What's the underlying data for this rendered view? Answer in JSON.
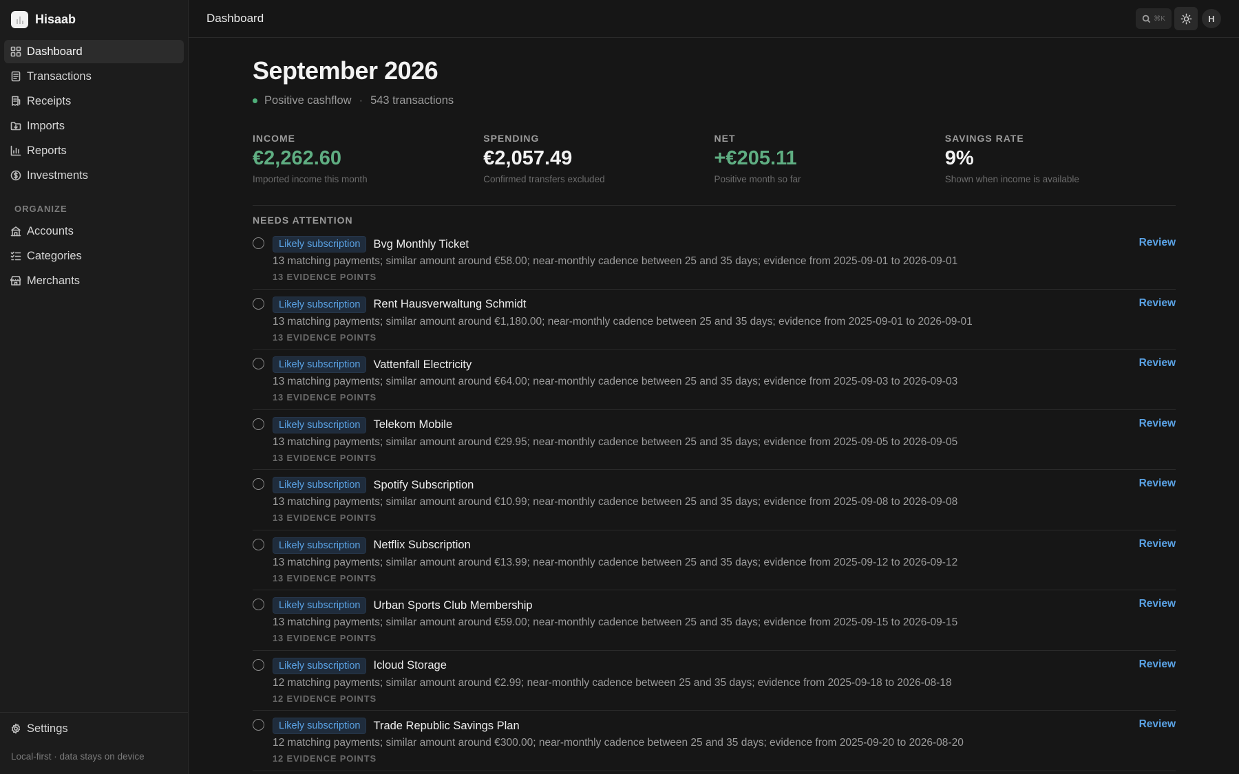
{
  "app": {
    "name": "Hisaab"
  },
  "sidebar": {
    "items": [
      {
        "label": "Dashboard",
        "icon": "dashboard-icon",
        "active": true
      },
      {
        "label": "Transactions",
        "icon": "transactions-icon"
      },
      {
        "label": "Receipts",
        "icon": "receipts-icon"
      },
      {
        "label": "Imports",
        "icon": "imports-icon"
      },
      {
        "label": "Reports",
        "icon": "reports-icon"
      },
      {
        "label": "Investments",
        "icon": "investments-icon"
      }
    ],
    "organize_label": "ORGANIZE",
    "organize_items": [
      {
        "label": "Accounts",
        "icon": "accounts-icon"
      },
      {
        "label": "Categories",
        "icon": "categories-icon"
      },
      {
        "label": "Merchants",
        "icon": "merchants-icon"
      }
    ],
    "settings_label": "Settings",
    "footnote": "Local-first · data stays on device"
  },
  "topbar": {
    "title": "Dashboard",
    "search_shortcut": "⌘K",
    "avatar_initial": "H"
  },
  "page": {
    "title": "September 2026",
    "status": "Positive cashflow",
    "separator": "·",
    "transactions_count": "543 transactions"
  },
  "stats": [
    {
      "label": "INCOME",
      "value": "€2,262.60",
      "note": "Imported income this month",
      "tone": "green"
    },
    {
      "label": "SPENDING",
      "value": "€2,057.49",
      "note": "Confirmed transfers excluded",
      "tone": "neutral"
    },
    {
      "label": "NET",
      "value": "+€205.11",
      "note": "Positive month so far",
      "tone": "green"
    },
    {
      "label": "SAVINGS RATE",
      "value": "9%",
      "note": "Shown when income is available",
      "tone": "neutral"
    }
  ],
  "attention": {
    "label": "NEEDS ATTENTION",
    "review_label": "Review",
    "items": [
      {
        "badge": "Likely subscription",
        "title": "Bvg Monthly Ticket",
        "desc": "13 matching payments; similar amount around €58.00; near-monthly cadence between 25 and 35 days; evidence from 2025-09-01 to 2026-09-01",
        "evidence": "13 EVIDENCE POINTS"
      },
      {
        "badge": "Likely subscription",
        "title": "Rent Hausverwaltung Schmidt",
        "desc": "13 matching payments; similar amount around €1,180.00; near-monthly cadence between 25 and 35 days; evidence from 2025-09-01 to 2026-09-01",
        "evidence": "13 EVIDENCE POINTS"
      },
      {
        "badge": "Likely subscription",
        "title": "Vattenfall Electricity",
        "desc": "13 matching payments; similar amount around €64.00; near-monthly cadence between 25 and 35 days; evidence from 2025-09-03 to 2026-09-03",
        "evidence": "13 EVIDENCE POINTS"
      },
      {
        "badge": "Likely subscription",
        "title": "Telekom Mobile",
        "desc": "13 matching payments; similar amount around €29.95; near-monthly cadence between 25 and 35 days; evidence from 2025-09-05 to 2026-09-05",
        "evidence": "13 EVIDENCE POINTS"
      },
      {
        "badge": "Likely subscription",
        "title": "Spotify Subscription",
        "desc": "13 matching payments; similar amount around €10.99; near-monthly cadence between 25 and 35 days; evidence from 2025-09-08 to 2026-09-08",
        "evidence": "13 EVIDENCE POINTS"
      },
      {
        "badge": "Likely subscription",
        "title": "Netflix Subscription",
        "desc": "13 matching payments; similar amount around €13.99; near-monthly cadence between 25 and 35 days; evidence from 2025-09-12 to 2026-09-12",
        "evidence": "13 EVIDENCE POINTS"
      },
      {
        "badge": "Likely subscription",
        "title": "Urban Sports Club Membership",
        "desc": "13 matching payments; similar amount around €59.00; near-monthly cadence between 25 and 35 days; evidence from 2025-09-15 to 2026-09-15",
        "evidence": "13 EVIDENCE POINTS"
      },
      {
        "badge": "Likely subscription",
        "title": "Icloud Storage",
        "desc": "12 matching payments; similar amount around €2.99; near-monthly cadence between 25 and 35 days; evidence from 2025-09-18 to 2026-08-18",
        "evidence": "12 EVIDENCE POINTS"
      },
      {
        "badge": "Likely subscription",
        "title": "Trade Republic Savings Plan",
        "desc": "12 matching payments; similar amount around €300.00; near-monthly cadence between 25 and 35 days; evidence from 2025-09-20 to 2026-08-20",
        "evidence": "12 EVIDENCE POINTS"
      }
    ]
  }
}
